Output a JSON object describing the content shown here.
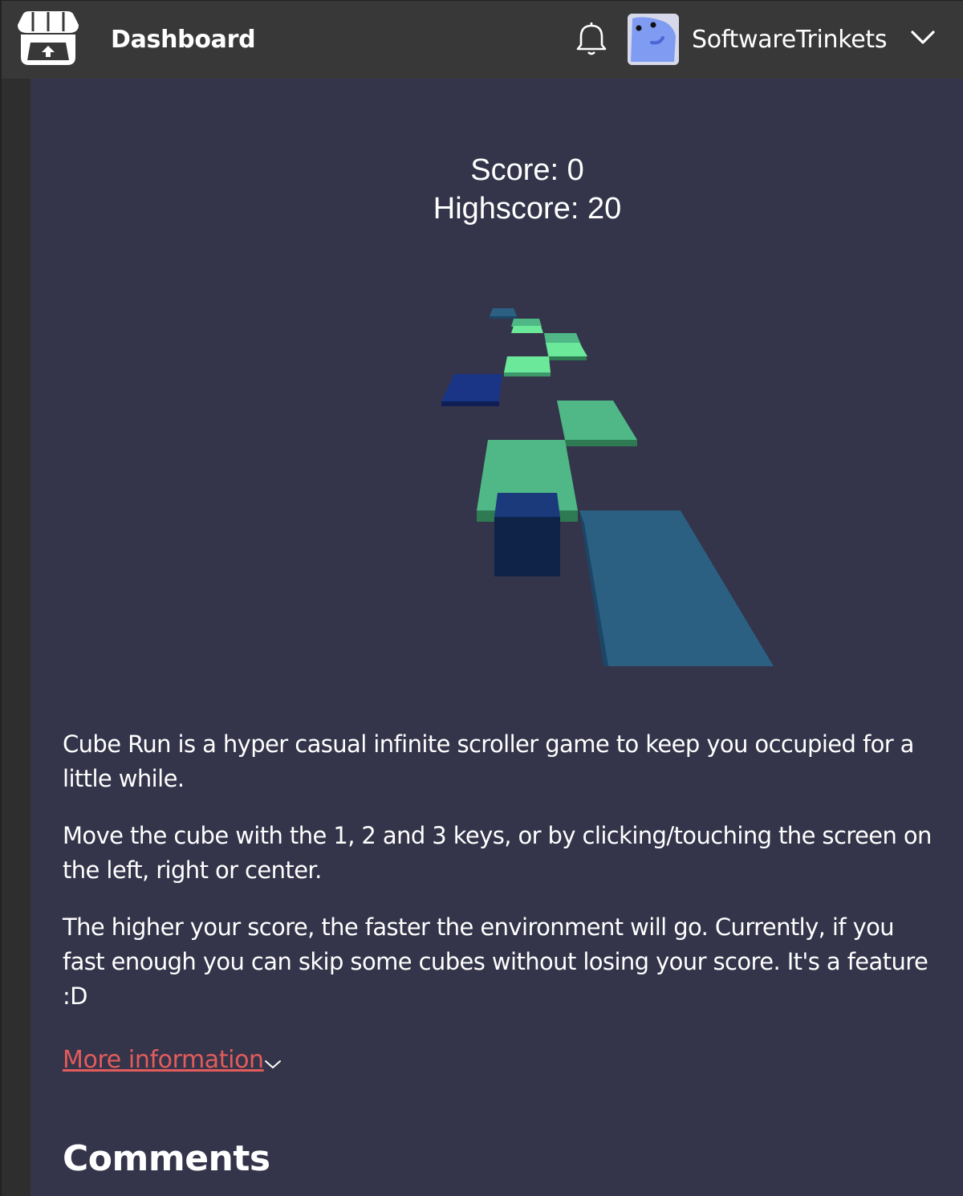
{
  "header": {
    "logo_icon": "itchio-logo-icon",
    "dashboard_label": "Dashboard",
    "notification_icon": "bell-icon",
    "username": "SoftwareTrinkets",
    "menu_icon": "chevron-down-icon"
  },
  "game": {
    "score_text": "Score: 0",
    "highscore_text": "Highscore: 20"
  },
  "description": {
    "paragraphs": [
      "Cube Run is a hyper casual infinite scroller game to keep you occupied for a little while.",
      "Move the cube with the 1, 2 and 3 keys, or by clicking/touching the screen on the left, right or center.",
      "The higher your score, the faster the environment will go. Currently, if you fast enough you can skip some cubes without losing your score. It's a feature :D"
    ]
  },
  "more_info": {
    "label": "More information",
    "icon": "chevron-down-icon"
  },
  "comments": {
    "heading": "Comments"
  },
  "colors": {
    "background": "#34344a",
    "topbar": "#383838",
    "link": "#e35c5c",
    "tile_green": "#4fb886",
    "tile_light_green": "#6ce89a",
    "tile_blue": "#2b6083",
    "tile_navy": "#1a3585",
    "player_cube": "#0e2347"
  }
}
